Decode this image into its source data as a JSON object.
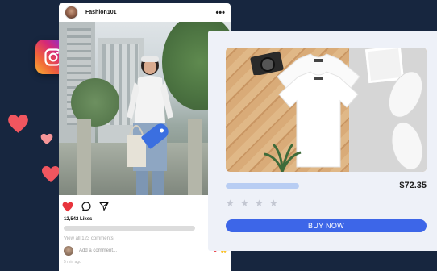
{
  "post": {
    "username": "Fashion101",
    "more_label": "•••",
    "likes": "12,542 Likes",
    "view_comments": "View all 123 comments",
    "add_comment_placeholder": "Add a comment...",
    "emojis": [
      "❤",
      "🙌"
    ],
    "time_ago": "5 min ago"
  },
  "product": {
    "price": "$72.35",
    "rating_stars": 0,
    "rating_max": 4,
    "buy_label": "BUY NOW"
  },
  "icons": {
    "brand": "instagram-icon",
    "like": "heart-icon",
    "comment": "comment-bubble-icon",
    "share": "send-icon",
    "tag": "price-tag-icon"
  },
  "colors": {
    "background": "#17263f",
    "accent": "#3d66e8",
    "heart": "#f1565f",
    "tag": "#3b6fe0"
  }
}
